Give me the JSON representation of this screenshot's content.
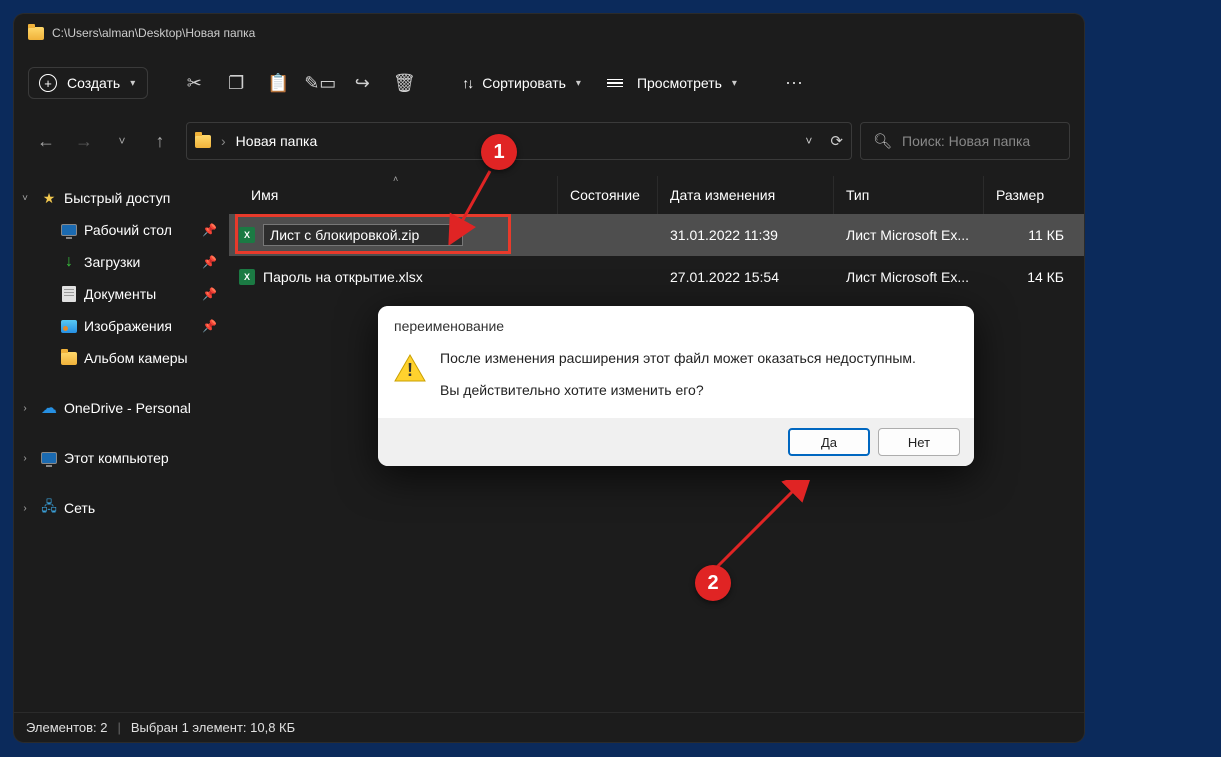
{
  "window": {
    "title_path": "C:\\Users\\alman\\Desktop\\Новая папка"
  },
  "toolbar": {
    "create_label": "Создать",
    "sort_label": "Сортировать",
    "view_label": "Просмотреть"
  },
  "address": {
    "current_folder": "Новая папка"
  },
  "search": {
    "placeholder": "Поиск: Новая папка"
  },
  "sidebar": {
    "quick_access": "Быстрый доступ",
    "desktop": "Рабочий стол",
    "downloads": "Загрузки",
    "documents": "Документы",
    "pictures": "Изображения",
    "camera_album": "Альбом камеры",
    "onedrive": "OneDrive - Personal",
    "this_pc": "Этот компьютер",
    "network": "Сеть"
  },
  "columns": {
    "name": "Имя",
    "state": "Состояние",
    "modified": "Дата изменения",
    "type": "Тип",
    "size": "Размер"
  },
  "files": [
    {
      "name": "Лист с блокировкой.zip",
      "modified": "31.01.2022 11:39",
      "type": "Лист Microsoft Ex...",
      "size": "11 КБ",
      "selected": true,
      "renaming": true
    },
    {
      "name": "Пароль на открытие.xlsx",
      "modified": "27.01.2022 15:54",
      "type": "Лист Microsoft Ex...",
      "size": "14 КБ",
      "selected": false,
      "renaming": false
    }
  ],
  "statusbar": {
    "items": "Элементов: 2",
    "selection": "Выбран 1 элемент: 10,8 КБ"
  },
  "dialog": {
    "title": "переименование",
    "line1": "После изменения расширения этот файл может оказаться недоступным.",
    "line2": "Вы действительно хотите изменить его?",
    "yes": "Да",
    "no": "Нет"
  },
  "callouts": {
    "one": "1",
    "two": "2"
  }
}
